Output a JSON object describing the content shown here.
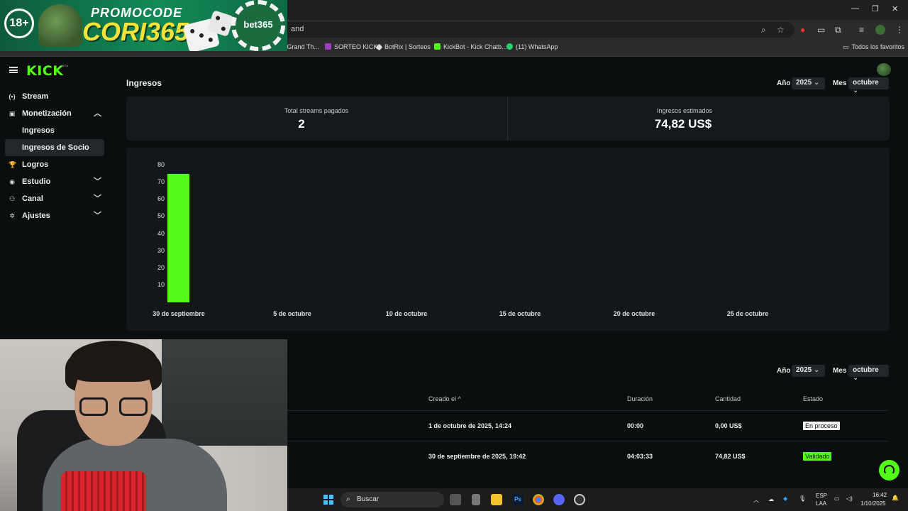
{
  "browser": {
    "url_fragment": "and",
    "bookmarks": [
      {
        "label": "se de Grand Th...",
        "color": "#7a7a7a"
      },
      {
        "label": "SORTEO KICK",
        "color": "#9b3fbf"
      },
      {
        "label": "BotRix | Sorteos",
        "color": "#dddddd"
      },
      {
        "label": "KickBot - Kick Chatb...",
        "color": "#53fc18"
      },
      {
        "label": "(11) WhatsApp",
        "color": "#25d366"
      }
    ],
    "favorites_label": "Todos los favoritos"
  },
  "ad": {
    "age_badge": "18+",
    "promo_line": "PROMOCODE",
    "code": "CORI365",
    "brand": "bet365"
  },
  "header": {
    "logo": "KICK",
    "logo_badge": "BETA"
  },
  "sidebar": {
    "items": [
      {
        "label": "Stream",
        "icon": "(•)"
      },
      {
        "label": "Monetización",
        "icon": "▣"
      },
      {
        "label": "Logros",
        "icon": "🏆"
      },
      {
        "label": "Estudio",
        "icon": "◉"
      },
      {
        "label": "Canal",
        "icon": "⚇"
      },
      {
        "label": "Ajustes",
        "icon": "✲"
      }
    ],
    "sub_items": [
      "Ingresos",
      "Ingresos de Socio"
    ]
  },
  "page": {
    "title": "Ingresos"
  },
  "filters": {
    "year_label": "Año",
    "year_value": "2025",
    "month_label": "Mes",
    "month_value": "octubre"
  },
  "stats": {
    "paid_label": "Total streams pagados",
    "paid_value": "2",
    "est_label": "Ingresos estimados",
    "est_value": "74,82 US$"
  },
  "chart_data": {
    "type": "bar",
    "categories": [
      "30 de septiembre"
    ],
    "values": [
      74.82
    ],
    "ylim": [
      0,
      80
    ],
    "y_ticks": [
      "80",
      "70",
      "60",
      "50",
      "40",
      "30",
      "20",
      "10"
    ],
    "x_ticks": [
      "30 de septiembre",
      "5 de octubre",
      "10 de octubre",
      "15 de octubre",
      "20 de octubre",
      "25 de octubre"
    ],
    "color": "#53fc18"
  },
  "table": {
    "headers": {
      "created": "Creado el ^",
      "duration": "Duración",
      "amount": "Cantidad",
      "status": "Estado"
    },
    "rows": [
      {
        "created": "1 de octubre de 2025, 14:24",
        "duration": "00:00",
        "amount": "0,00 US$",
        "status": "En proceso"
      },
      {
        "created": "30 de septiembre de 2025, 19:42",
        "duration": "04:03:33",
        "amount": "74,82 US$",
        "status": "Validado"
      }
    ]
  },
  "taskbar": {
    "search": "Buscar",
    "lang_top": "ESP",
    "lang_bottom": "LAA",
    "time": "16:42",
    "date": "1/10/2025"
  }
}
